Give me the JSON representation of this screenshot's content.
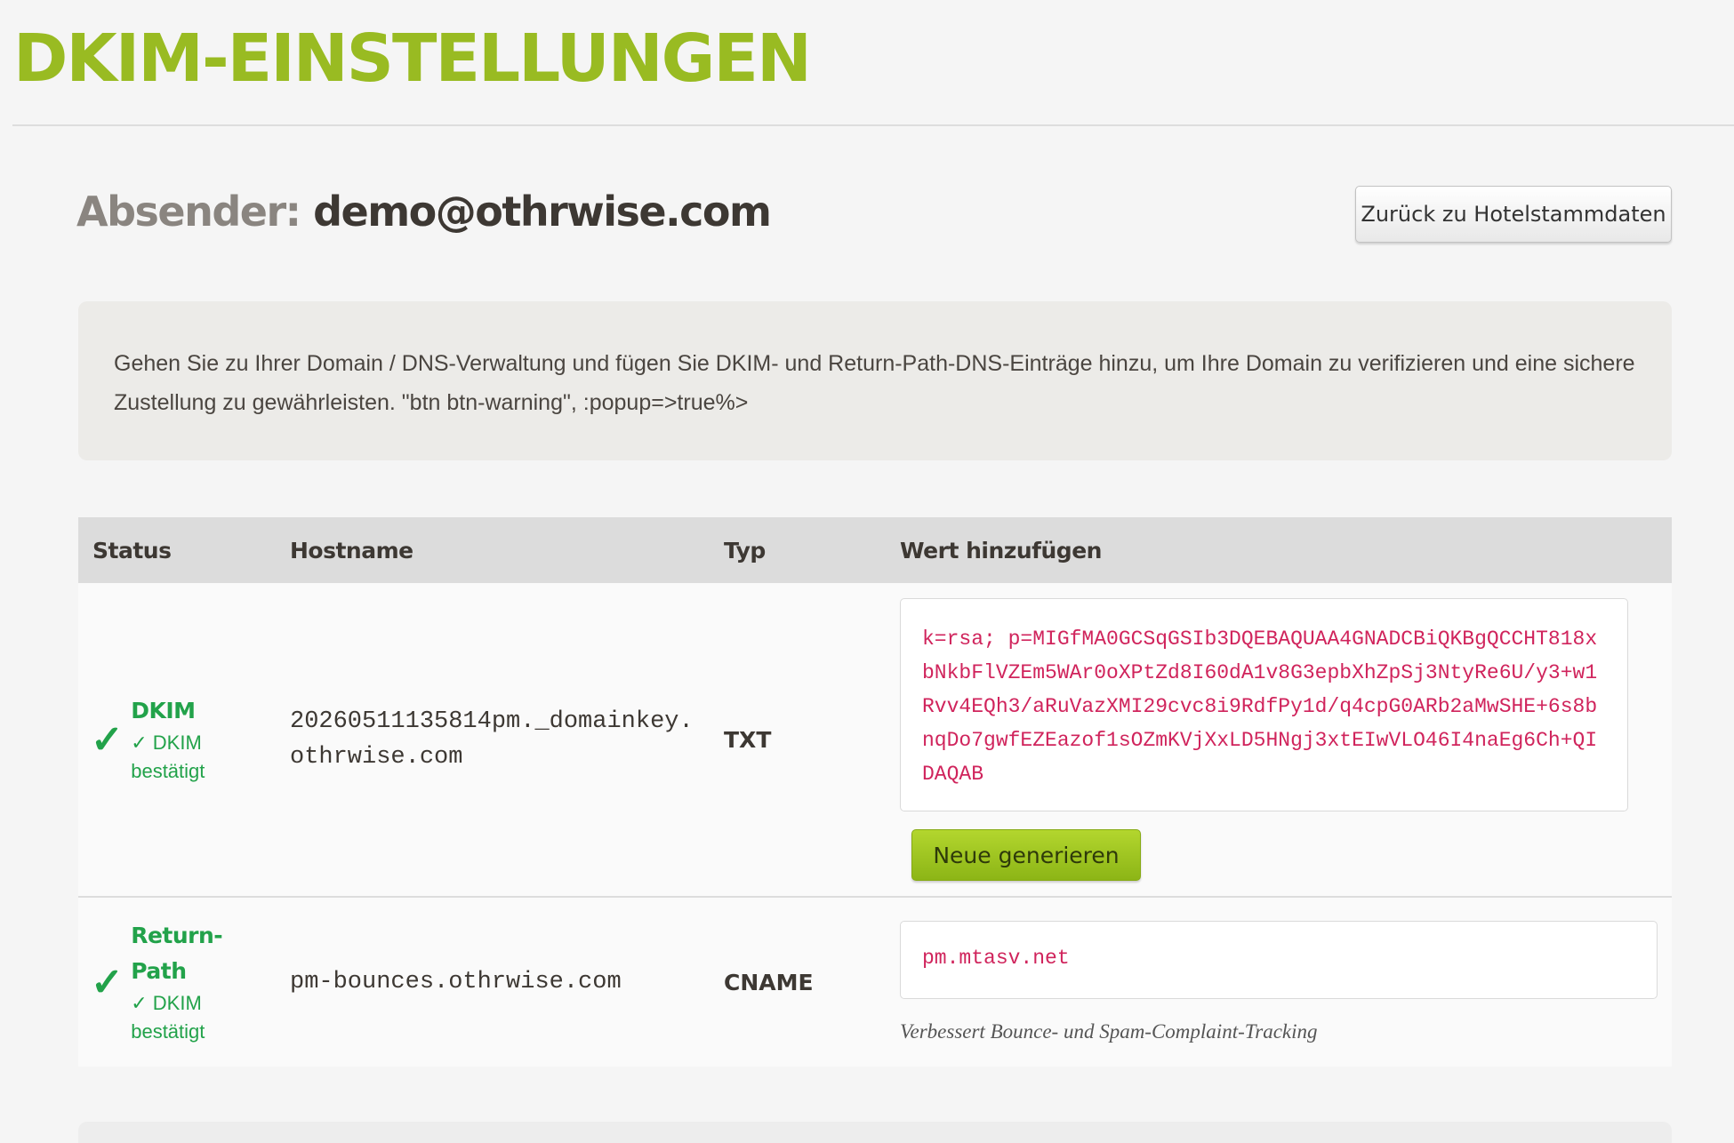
{
  "page": {
    "title": "DKIM-EINSTELLUNGEN"
  },
  "sender": {
    "label": "Absender:",
    "email": "demo@othrwise.com"
  },
  "actions": {
    "back_label": "Zurück zu Hotelstammdaten"
  },
  "info": {
    "text": "Gehen Sie zu Ihrer Domain / DNS-Verwaltung und fügen Sie DKIM- und Return-Path-DNS-Einträge hinzu, um Ihre Domain zu verifizieren und eine sichere Zustellung zu gewährleisten. \"btn btn-warning\", :popup=>true%>"
  },
  "table": {
    "headers": [
      "Status",
      "Hostname",
      "Typ",
      "Wert hinzufügen"
    ],
    "rows": [
      {
        "status_icon": "✓",
        "status_name": "DKIM",
        "status_sub": "✓ DKIM bestätigt",
        "hostname": "20260511135814pm._domainkey.othrwise.com",
        "type": "TXT",
        "value": "k=rsa; p=MIGfMA0GCSqGSIb3DQEBAQUAA4GNADCBiQKBgQCCHT818xbNkbFlVZEm5WAr0oXPtZd8I60dA1v8G3epbXhZpSj3NtyRe6U/y3+w1Rvv4EQh3/aRuVazXMI29cvc8i9RdfPy1d/q4cpG0ARb2aMwSHE+6s8bnqDo7gwfEZEazof1sOZmKVjXxLD5HNgj3xtEIwVLO46I4naEg6Ch+QIDAQAB",
        "regen_label": "Neue generieren"
      },
      {
        "status_icon": "✓",
        "status_name": "Return-Path",
        "status_sub": "✓ DKIM bestätigt",
        "hostname": "pm-bounces.othrwise.com",
        "type": "CNAME",
        "value": "pm.mtasv.net",
        "note": "Verbessert Bounce- und Spam-Complaint-Tracking"
      }
    ]
  },
  "colors": {
    "brand": "#99bb22",
    "success": "#22a24a",
    "code": "#d0245c"
  }
}
